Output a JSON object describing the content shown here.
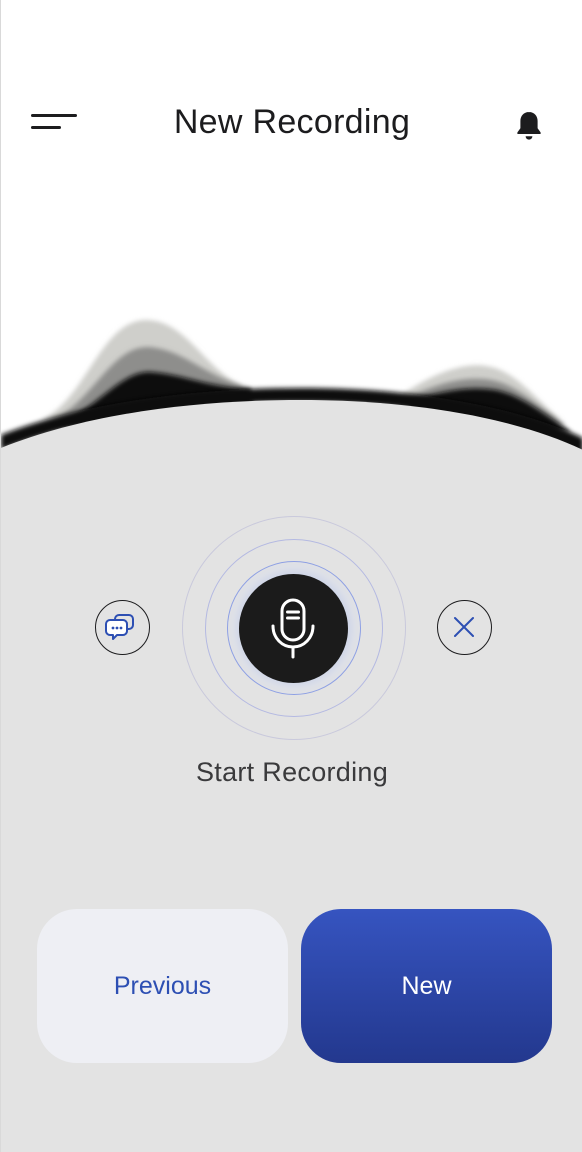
{
  "header": {
    "title": "New Recording",
    "menu_icon": "hamburger-icon",
    "notification_icon": "bell-icon"
  },
  "recorder": {
    "status_label": "Start Recording",
    "mic_icon": "microphone-icon",
    "left_action_icon": "chat-bubbles-icon",
    "right_action_icon": "close-icon"
  },
  "actions": {
    "previous_label": "Previous",
    "new_label": "New"
  },
  "colors": {
    "accent_blue": "#2d4fb3",
    "new_button_top": "#3654c0",
    "new_button_bottom": "#23388e",
    "panel_gray": "#e3e3e3",
    "mic_button": "#1b1b1b"
  }
}
